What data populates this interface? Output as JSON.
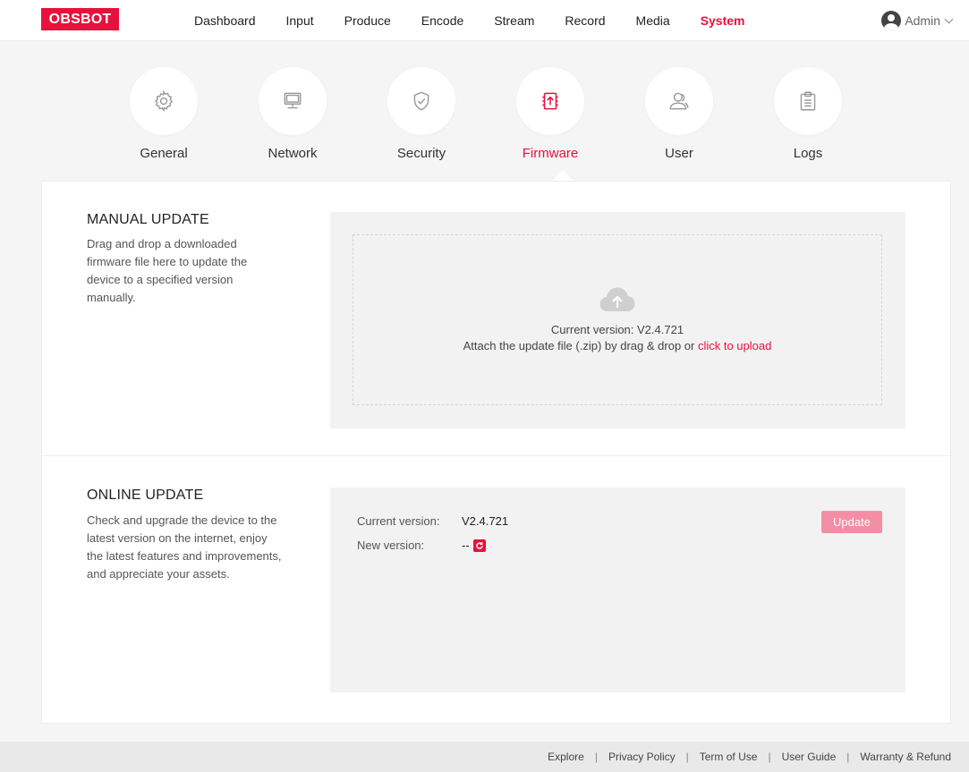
{
  "brand": {
    "logo_text": "OBSBOT",
    "accent_color": "#e8103c"
  },
  "nav": {
    "items": [
      {
        "label": "Dashboard"
      },
      {
        "label": "Input"
      },
      {
        "label": "Produce"
      },
      {
        "label": "Encode"
      },
      {
        "label": "Stream"
      },
      {
        "label": "Record"
      },
      {
        "label": "Media"
      },
      {
        "label": "System",
        "active": true
      }
    ]
  },
  "user": {
    "name": "Admin",
    "icon": "avatar-icon"
  },
  "categories": [
    {
      "label": "General",
      "icon": "gear-icon"
    },
    {
      "label": "Network",
      "icon": "monitor-icon"
    },
    {
      "label": "Security",
      "icon": "shield-check-icon"
    },
    {
      "label": "Firmware",
      "icon": "firmware-upload-icon",
      "active": true
    },
    {
      "label": "User",
      "icon": "users-icon"
    },
    {
      "label": "Logs",
      "icon": "clipboard-icon"
    }
  ],
  "manual_update": {
    "title": "MANUAL UPDATE",
    "description": "Drag and drop a downloaded firmware file here to update the device to a specified version manually.",
    "current_version_line": "Current version: V2.4.721",
    "attach_text": "Attach the update file (.zip) by drag & drop or ",
    "upload_link": "click to upload"
  },
  "online_update": {
    "title": "ONLINE UPDATE",
    "description": "Check and upgrade the device to the latest version on the internet, enjoy the latest features and improvements, and appreciate your assets.",
    "current_version_label": "Current version:",
    "current_version_value": "V2.4.721",
    "new_version_label": "New version:",
    "new_version_value": "--",
    "update_button": "Update"
  },
  "footer": {
    "links": [
      "Explore",
      "Privacy Policy",
      "Term of Use",
      "User Guide",
      "Warranty & Refund"
    ],
    "separator": "|"
  }
}
